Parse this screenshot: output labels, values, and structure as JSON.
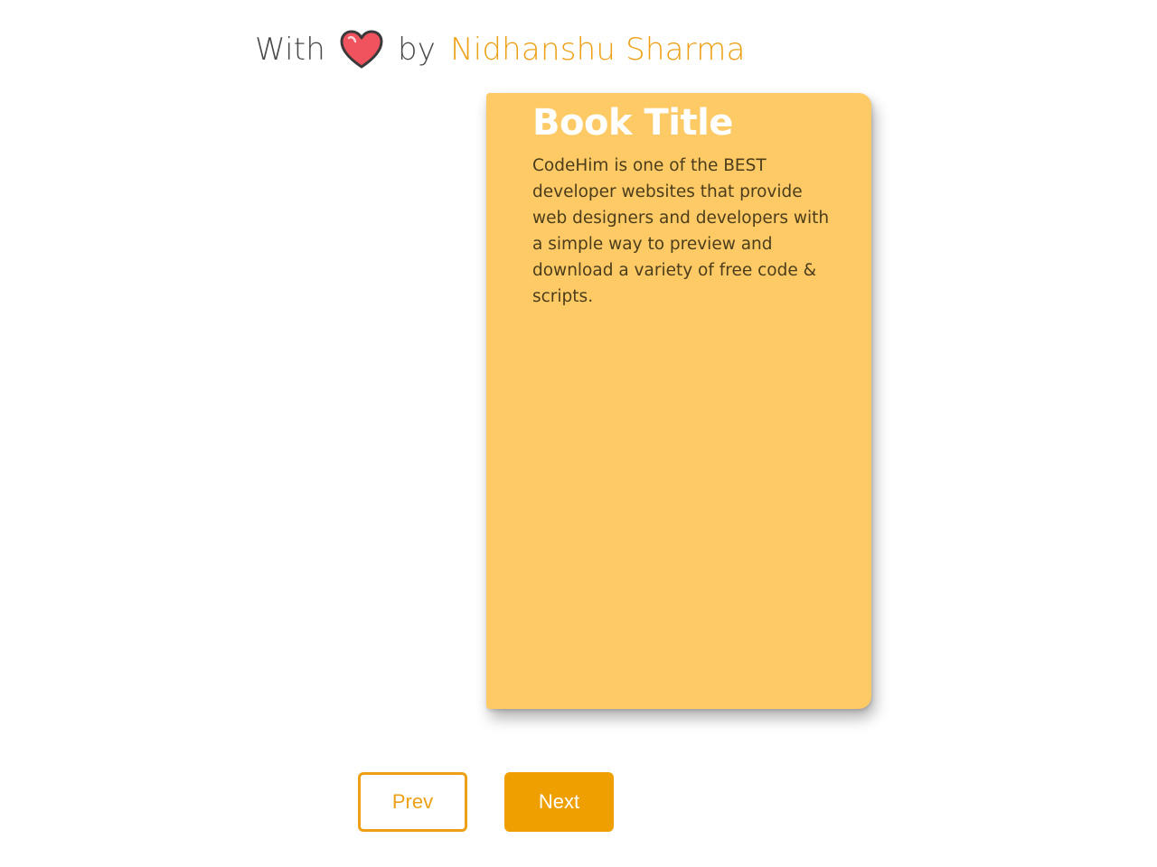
{
  "credit": {
    "prefix": "With",
    "icon": "heart-icon",
    "by": "by",
    "author": "Nidhanshu Sharma"
  },
  "book": {
    "title": "Book Title",
    "description": "CodeHim is one of the BEST developer websites that provide web designers and developers with a simple way to preview and download a variety of free code & scripts."
  },
  "controls": {
    "prev_label": "Prev",
    "next_label": "Next"
  },
  "colors": {
    "accent": "#eda015",
    "book_cover": "#fdca65",
    "heart": "#f0525e"
  }
}
